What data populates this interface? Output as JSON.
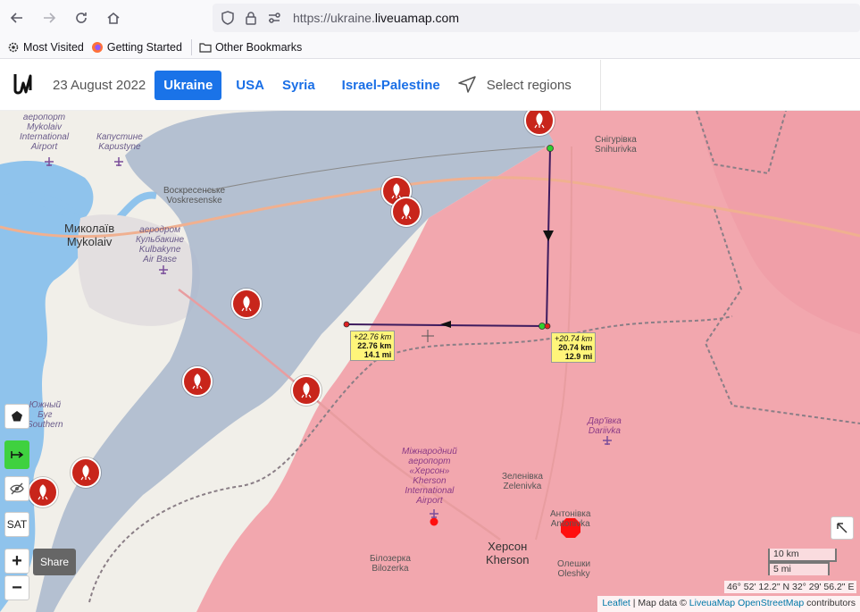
{
  "browser": {
    "url_prefix": "https://ukraine.",
    "url_host": "liveuamap.com",
    "bookmarks": [
      "Most Visited",
      "Getting Started",
      "Other Bookmarks"
    ]
  },
  "header": {
    "date": "23 August 2022",
    "regions": [
      "Ukraine",
      "USA",
      "Syria",
      "Israel-Palestine"
    ],
    "select_regions": "Select regions"
  },
  "map": {
    "labels": {
      "mykolaiv_airport": [
        "аеропорт",
        "Mykolaiv",
        "International",
        "Airport"
      ],
      "kapustyne": [
        "Капустине",
        "Kapustyne"
      ],
      "voskresenske": [
        "Воскресенське",
        "Voskresenske"
      ],
      "mykolaiv": [
        "Миколаїв",
        "Mykolaiv"
      ],
      "kulbakyne": [
        "аеродром",
        "Кульбакине",
        "Kulbakyne",
        "Air Base"
      ],
      "snihurivka": [
        "Снігурівка",
        "Snihurivka"
      ],
      "dariivka": [
        "Дар'ївка",
        "Dariivka"
      ],
      "kherson_airport": [
        "Міжнародний",
        "аеропорт",
        "«Херсон»",
        "Kherson",
        "International",
        "Airport"
      ],
      "zelenivka": [
        "Зеленівка",
        "Zelenivka"
      ],
      "antonivka": [
        "Антонівка",
        "Antonivka"
      ],
      "kherson": [
        "Херсон",
        "Kherson"
      ],
      "olenky": [
        "Олешки",
        "Oleshky"
      ],
      "bilozerka": [
        "Білозерка",
        "Bilozerka"
      ],
      "pivdennyi_buh": [
        "Южный",
        "Буг",
        "Southern"
      ]
    },
    "measure_west": {
      "delta": "+22.76 km",
      "km": "22.76 km",
      "mi": "14.1 mi"
    },
    "measure_south": {
      "delta": "+20.74 km",
      "km": "20.74 km",
      "mi": "12.9 mi"
    },
    "controls": {
      "share": "Share",
      "sat": "SAT",
      "zoom_in": "+",
      "zoom_out": "−"
    },
    "scale": {
      "km": "10 km",
      "mi": "5 mi"
    },
    "coords": "46° 52' 12.2\" N 32° 29' 56.2\" E",
    "attribution": {
      "leaflet": "Leaflet",
      "map_data": " | Map data © ",
      "liveua": "LiveuaMap",
      "osm": "OpenStreetMap",
      "contrib": " contributors"
    },
    "colors": {
      "occupied": "#f2a7ae",
      "contested": "#a9b7cc",
      "water": "#8fc3ec",
      "land": "#f1efe9",
      "bomb": "#c8251b"
    }
  }
}
